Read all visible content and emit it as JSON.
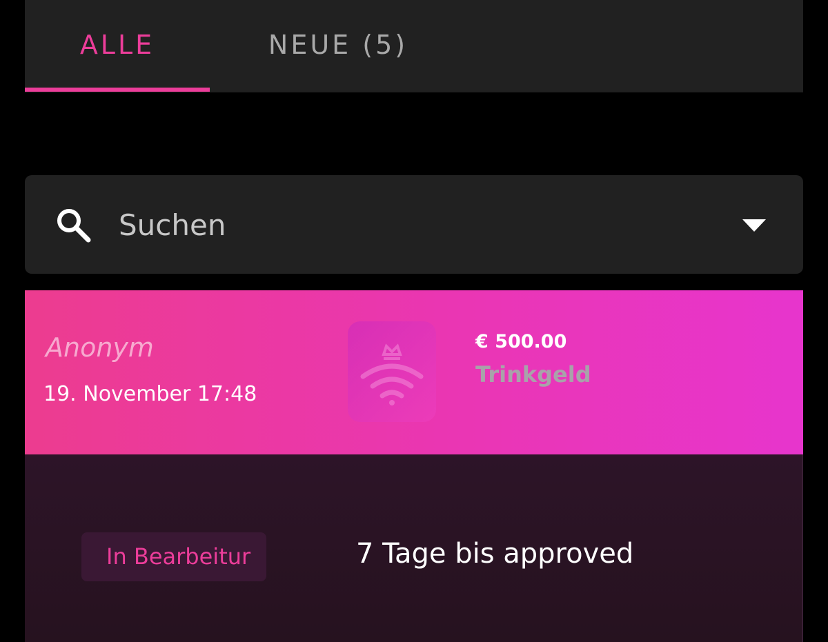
{
  "tabs": [
    {
      "label": "ALLE",
      "active": true
    },
    {
      "label": "NEUE (5)",
      "active": false
    }
  ],
  "search": {
    "placeholder": "Suchen",
    "icon": "search-icon",
    "dropdown_icon": "caret-down-icon"
  },
  "transaction": {
    "sender": "Anonym",
    "datetime": "19. November 17:48",
    "amount": "€ 500.00",
    "type": "Trinkgeld",
    "logo_icon": "crown-wifi-logo",
    "status": "In Bearbeitur",
    "approval": "7 Tage bis approved"
  },
  "colors": {
    "accent": "#ec3d9a",
    "background": "#000000",
    "surface": "#212121",
    "card_gradient_start": "#ec3c8f",
    "card_gradient_end": "#e735cd",
    "card_body": "#2d1428"
  }
}
